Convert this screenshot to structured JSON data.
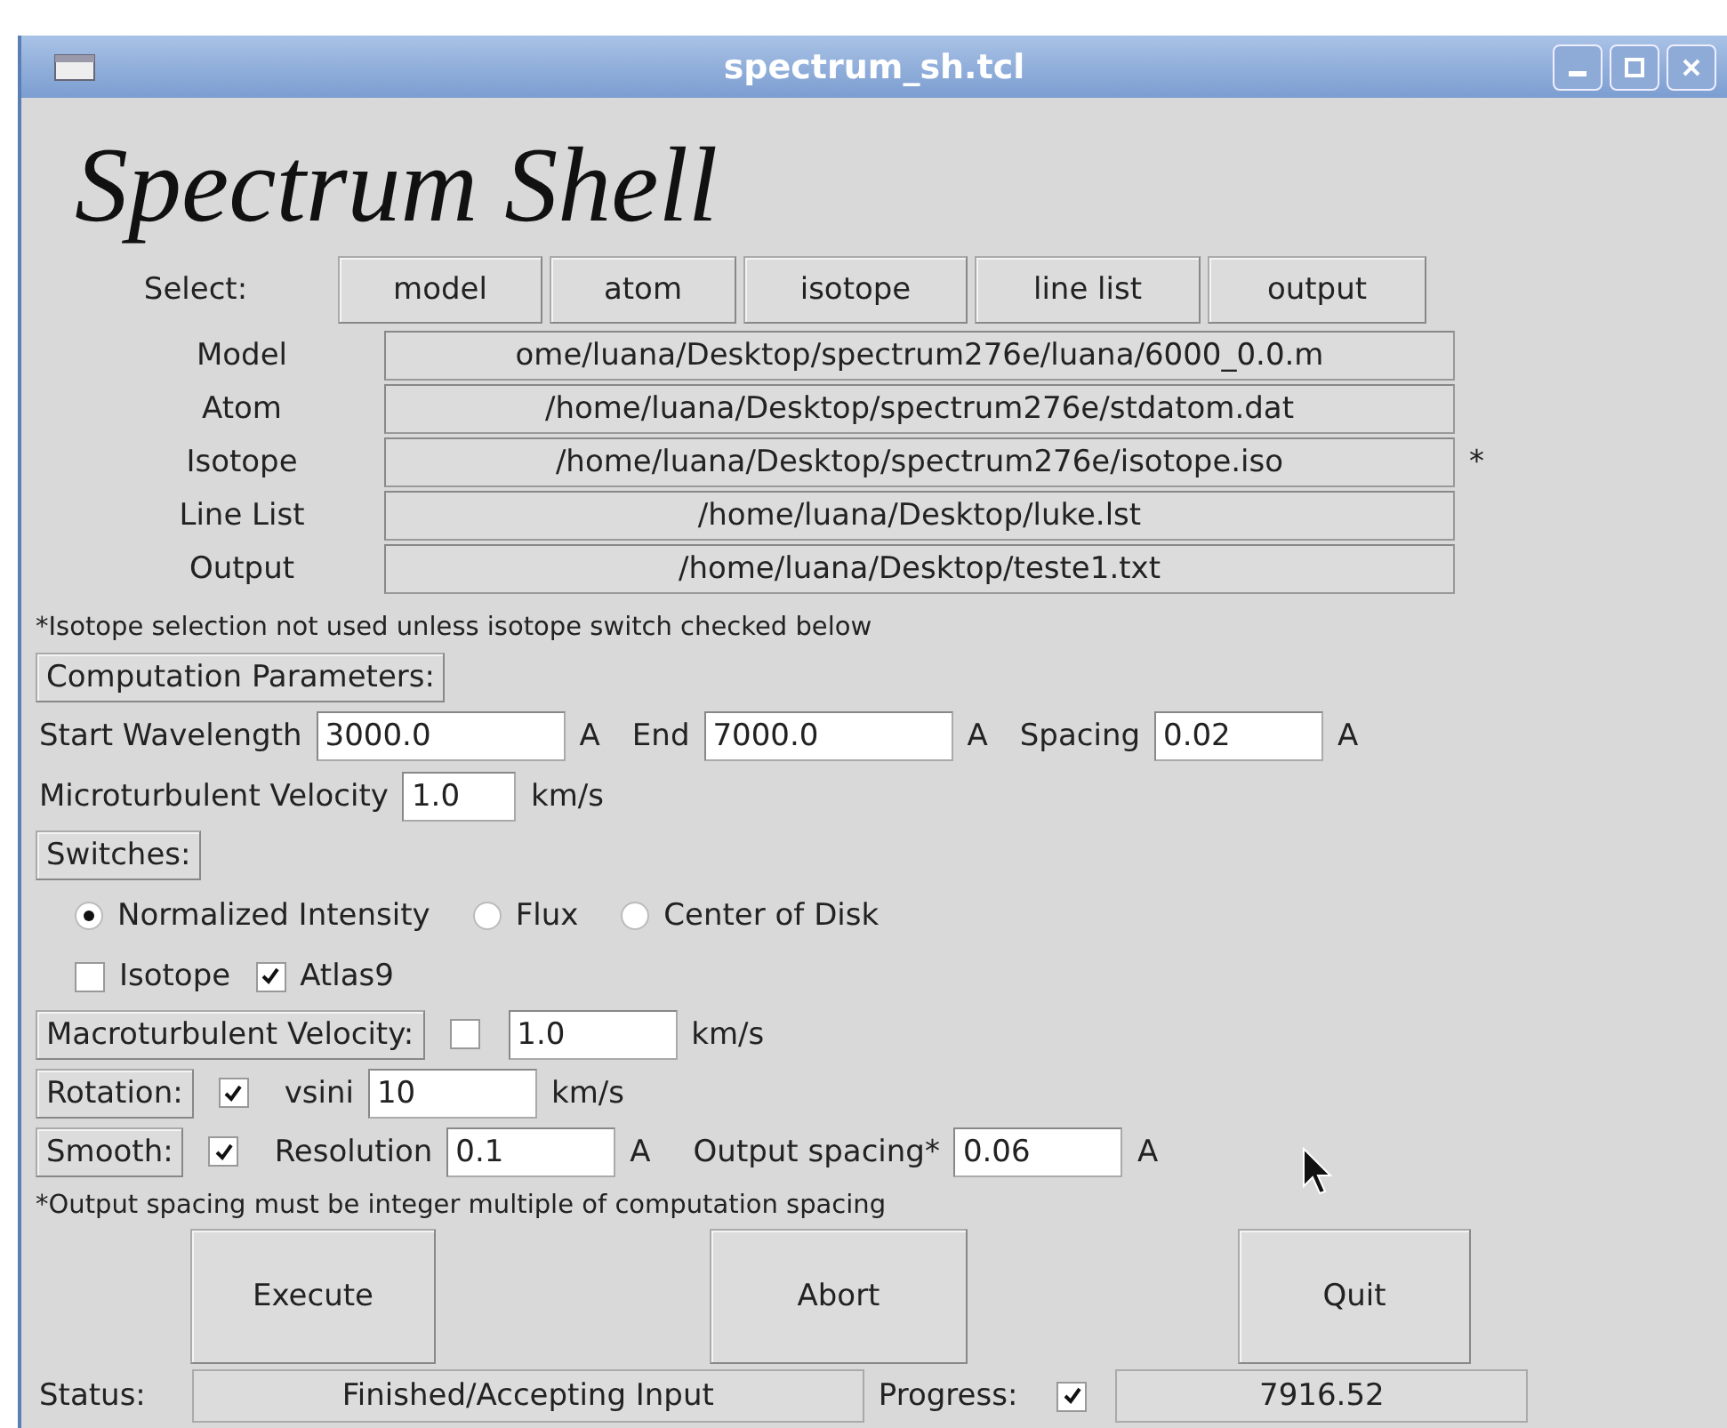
{
  "window": {
    "title": "spectrum_sh.tcl"
  },
  "app_title": "Spectrum Shell",
  "select": {
    "label": "Select:",
    "buttons": [
      "model",
      "atom",
      "isotope",
      "line list",
      "output"
    ]
  },
  "files": [
    {
      "label": "Model",
      "value": "ome/luana/Desktop/spectrum276e/luana/6000_0.0.m"
    },
    {
      "label": "Atom",
      "value": "/home/luana/Desktop/spectrum276e/stdatom.dat"
    },
    {
      "label": "Isotope",
      "value": "/home/luana/Desktop/spectrum276e/isotope.iso",
      "marker": "*"
    },
    {
      "label": "Line List",
      "value": "/home/luana/Desktop/luke.lst"
    },
    {
      "label": "Output",
      "value": "/home/luana/Desktop/teste1.txt"
    }
  ],
  "isotope_note": "*Isotope selection not used unless isotope switch checked below",
  "parameters": {
    "header": "Computation Parameters:",
    "rows": [
      [
        {
          "label": "Start Wavelength",
          "value": "3000.0",
          "unit": "A"
        },
        {
          "label": "End",
          "value": "7000.0",
          "unit": "A"
        },
        {
          "label": "Spacing",
          "value": "0.02",
          "unit": "A"
        }
      ],
      [
        {
          "label": "Microturbulent Velocity",
          "value": "1.0",
          "unit": "km/s"
        }
      ]
    ]
  },
  "switches": {
    "header": "Switches:",
    "radios": [
      {
        "label": "Normalized Intensity",
        "selected": true
      },
      {
        "label": "Flux",
        "selected": false
      },
      {
        "label": "Center of Disk",
        "selected": false
      }
    ],
    "checks": [
      {
        "label": "Isotope",
        "checked": false
      },
      {
        "label": "Atlas9",
        "checked": true
      }
    ]
  },
  "options": [
    {
      "button": "Macroturbulent Velocity:",
      "checked": false,
      "fields": [
        {
          "value": "1.0",
          "unit": "km/s"
        }
      ]
    },
    {
      "button": "Rotation:",
      "checked": true,
      "fields": [
        {
          "label": "vsini",
          "value": "10",
          "unit": "km/s"
        }
      ]
    },
    {
      "button": "Smooth:",
      "checked": true,
      "fields": [
        {
          "label": "Resolution",
          "value": "0.1",
          "unit": "A"
        },
        {
          "label": "Output spacing*",
          "value": "0.06",
          "unit": "A"
        }
      ]
    }
  ],
  "spacing_note": "*Output spacing must be integer multiple of computation spacing",
  "actions": [
    "Execute",
    "Abort",
    "Quit"
  ],
  "status": {
    "label": "Status:",
    "value": "Finished/Accepting Input",
    "progress_label": "Progress:",
    "progress_checked": true,
    "progress_value": "7916.52"
  }
}
